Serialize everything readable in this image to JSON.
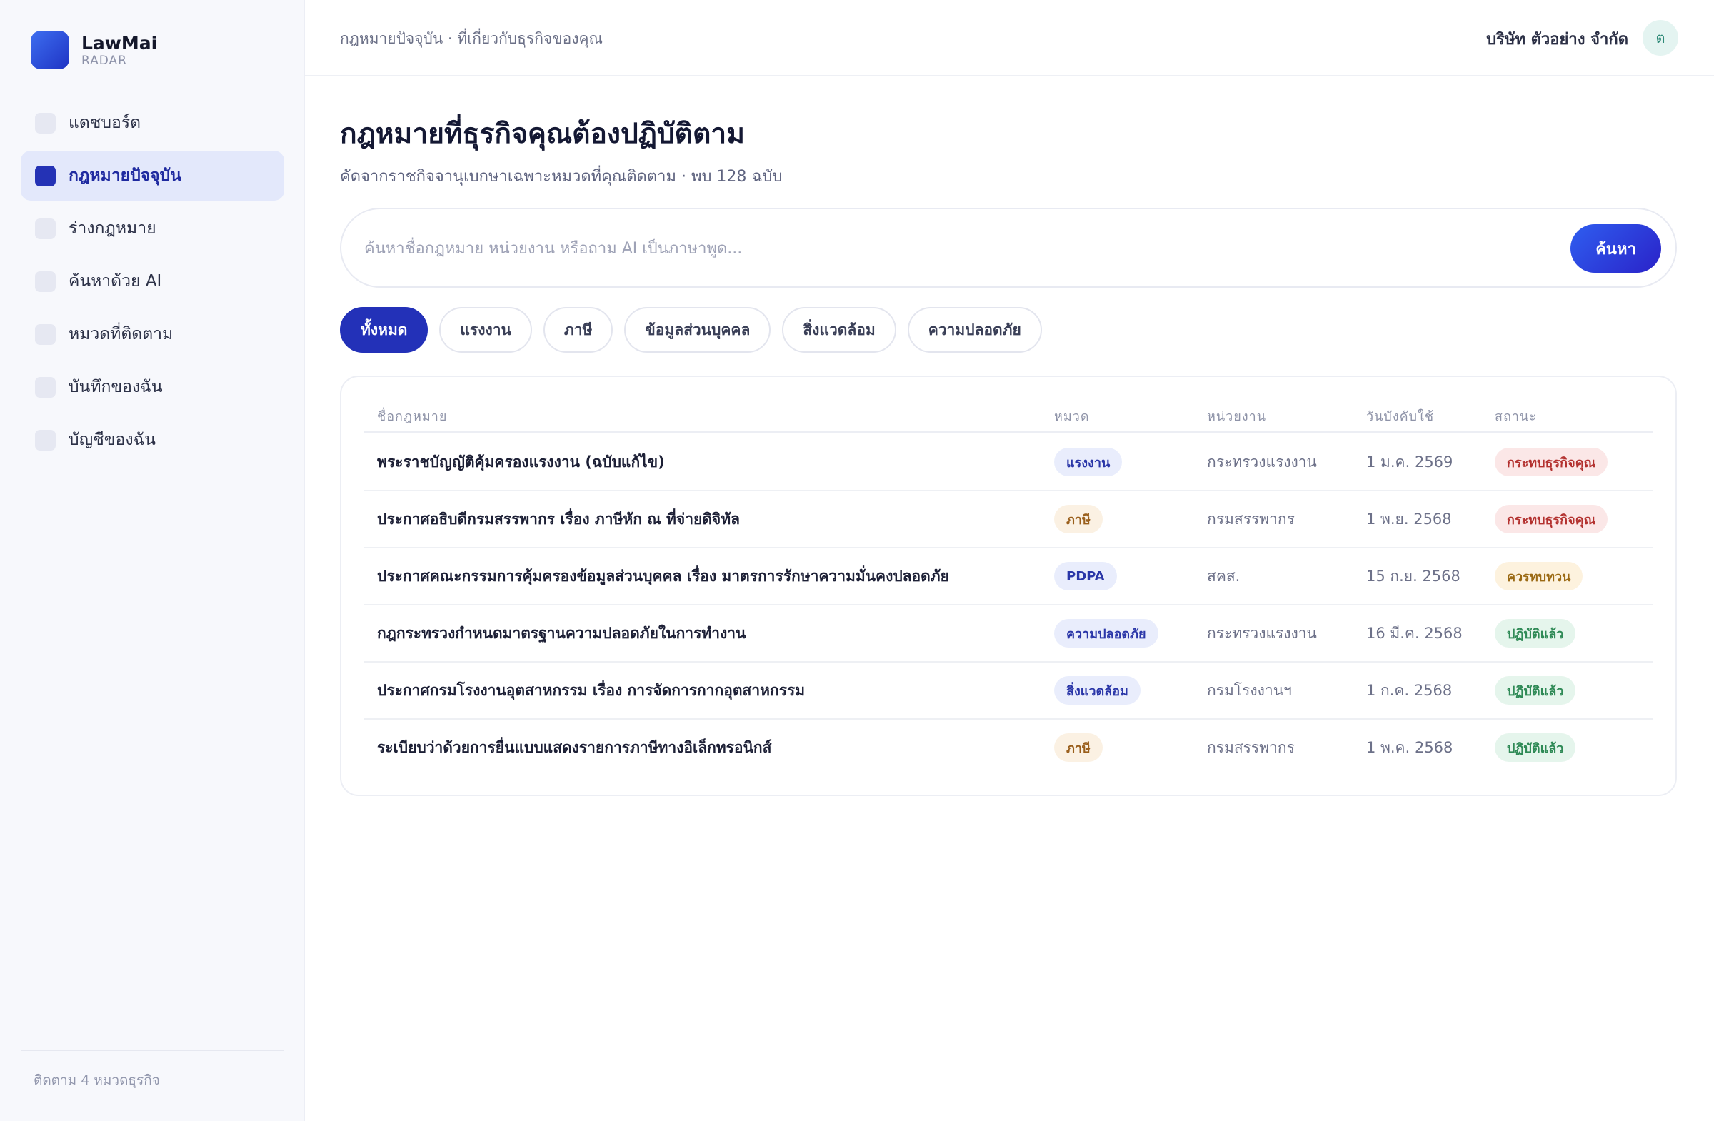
{
  "app": {
    "name": "LawMai",
    "sub": "RADAR"
  },
  "sidebar": {
    "items": [
      {
        "label": "แดชบอร์ด",
        "active": false
      },
      {
        "label": "กฎหมายปัจจุบัน",
        "active": true
      },
      {
        "label": "ร่างกฎหมาย",
        "active": false
      },
      {
        "label": "ค้นหาด้วย AI",
        "active": false
      },
      {
        "label": "หมวดที่ติดตาม",
        "active": false
      },
      {
        "label": "บันทึกของฉัน",
        "active": false
      },
      {
        "label": "บัญชีของฉัน",
        "active": false
      }
    ],
    "footer": "ติดตาม 4 หมวดธุรกิจ"
  },
  "topbar": {
    "breadcrumb": "กฎหมายปัจจุบัน · ที่เกี่ยวกับธุรกิจของคุณ",
    "company": "บริษัท ตัวอย่าง จำกัด",
    "avatar_initial": "ต"
  },
  "main": {
    "title": "กฎหมายที่ธุรกิจคุณต้องปฏิบัติตาม",
    "subtitle": "คัดจากราชกิจจานุเบกษาเฉพาะหมวดที่คุณติดตาม · พบ 128 ฉบับ",
    "search": {
      "placeholder": "ค้นหาชื่อกฎหมาย หน่วยงาน หรือถาม AI เป็นภาษาพูด...",
      "button": "ค้นหา"
    },
    "filters": [
      "ทั้งหมด",
      "แรงงาน",
      "ภาษี",
      "ข้อมูลส่วนบุคคล",
      "สิ่งแวดล้อม",
      "ความปลอดภัย"
    ],
    "active_filter": "ทั้งหมด"
  },
  "table": {
    "headers": {
      "name": "ชื่อกฎหมาย",
      "category": "หมวด",
      "agency": "หน่วยงาน",
      "effective": "วันบังคับใช้",
      "status": "สถานะ"
    },
    "rows": [
      {
        "name": "พระราชบัญญัติคุ้มครองแรงงาน (ฉบับแก้ไข)",
        "category": "แรงงาน",
        "agency": "กระทรวงแรงงาน",
        "effective": "1 ม.ค. 2569",
        "status": "กระทบธุรกิจคุณ"
      },
      {
        "name": "ประกาศอธิบดีกรมสรรพากร เรื่อง ภาษีหัก ณ ที่จ่ายดิจิทัล",
        "category": "ภาษี",
        "agency": "กรมสรรพากร",
        "effective": "1 พ.ย. 2568",
        "status": "กระทบธุรกิจคุณ"
      },
      {
        "name": "ประกาศคณะกรรมการคุ้มครองข้อมูลส่วนบุคคล เรื่อง มาตรการรักษาความมั่นคงปลอดภัย",
        "category": "PDPA",
        "agency": "สคส.",
        "effective": "15 ก.ย. 2568",
        "status": "ควรทบทวน"
      },
      {
        "name": "กฎกระทรวงกำหนดมาตรฐานความปลอดภัยในการทำงาน",
        "category": "ความปลอดภัย",
        "agency": "กระทรวงแรงงาน",
        "effective": "16 มี.ค. 2568",
        "status": "ปฏิบัติแล้ว"
      },
      {
        "name": "ประกาศกรมโรงงานอุตสาหกรรม เรื่อง การจัดการกากอุตสาหกรรม",
        "category": "สิ่งแวดล้อม",
        "agency": "กรมโรงงานฯ",
        "effective": "1 ก.ค. 2568",
        "status": "ปฏิบัติแล้ว"
      },
      {
        "name": "ระเบียบว่าด้วยการยื่นแบบแสดงรายการภาษีทางอิเล็กทรอนิกส์",
        "category": "ภาษี",
        "agency": "กรมสรรพากร",
        "effective": "1 พ.ค. 2568",
        "status": "ปฏิบัติแล้ว"
      }
    ]
  },
  "colors": {
    "accent": "#2331b8",
    "status_affects": "#b3312f",
    "status_review": "#9b6a14",
    "status_done": "#2f8a56"
  }
}
